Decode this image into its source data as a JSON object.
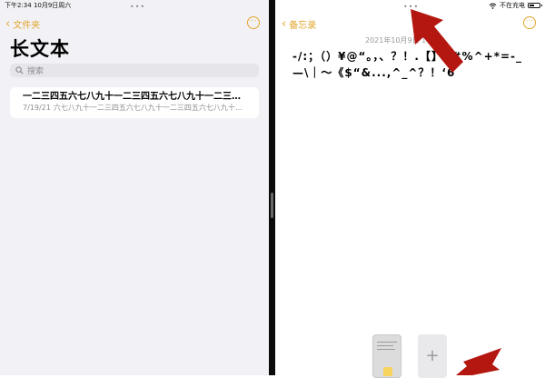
{
  "left_pane": {
    "status_time": "下午2:34  10月9日周六",
    "back_label": "文件夹",
    "title": "长文本",
    "search_placeholder": "搜索",
    "note": {
      "title": "一二三四五六七八九十一二三四五六七八九十一二三四五六七八九十",
      "date": "7/19/21",
      "preview": "六七八九十一二三四五六七八九十一二三四五六七八九十一二三四五六七八九十"
    }
  },
  "right_pane": {
    "status_charging": "不在充电",
    "battery_level": 0.5,
    "back_label": "备忘录",
    "note_datetime": "2021年10月9日 14:28",
    "note_body": "-/:；（）¥@“。，、？！.【】{#%^+*=-_—\\｜～《$“&...,^_^？！‘6"
  },
  "dock": {
    "add_label": "+"
  },
  "icons": {
    "ellipsis": "•••",
    "chevron": "‹",
    "more": "···"
  },
  "colors": {
    "accent": "#e2a52c",
    "arrow": "#b3170f"
  }
}
